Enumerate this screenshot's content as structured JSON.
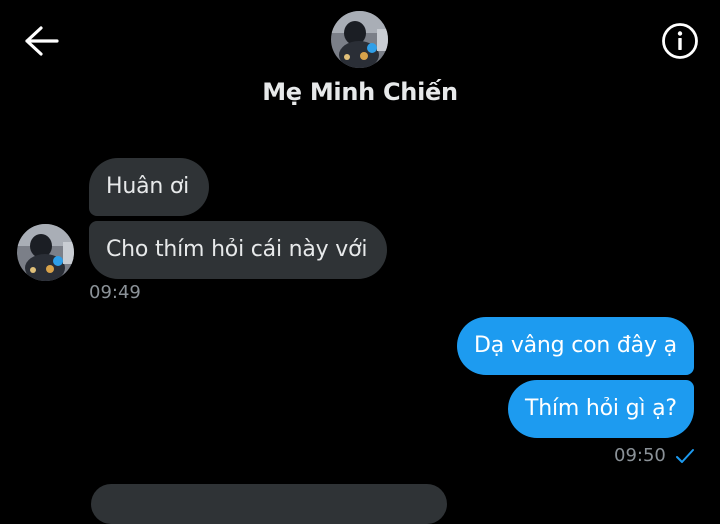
{
  "header": {
    "title": "Mẹ Minh Chiến",
    "back_icon": "arrow-left-icon",
    "info_icon": "info-circle-icon"
  },
  "conversation": {
    "incoming": {
      "messages": [
        {
          "text": "Huân ơi"
        },
        {
          "text": "Cho thím hỏi cái này với"
        }
      ],
      "time": "09:49"
    },
    "outgoing": {
      "messages": [
        {
          "text": "Dạ vâng con đây ạ"
        },
        {
          "text": "Thím hỏi gì ạ?"
        }
      ],
      "time": "09:50",
      "status_icon": "checkmark-icon"
    }
  },
  "colors": {
    "background": "#000000",
    "incoming_bubble": "#2f3336",
    "outgoing_bubble": "#1d9bf0",
    "timestamp": "#8b9298",
    "read_check": "#1d9bf0"
  }
}
